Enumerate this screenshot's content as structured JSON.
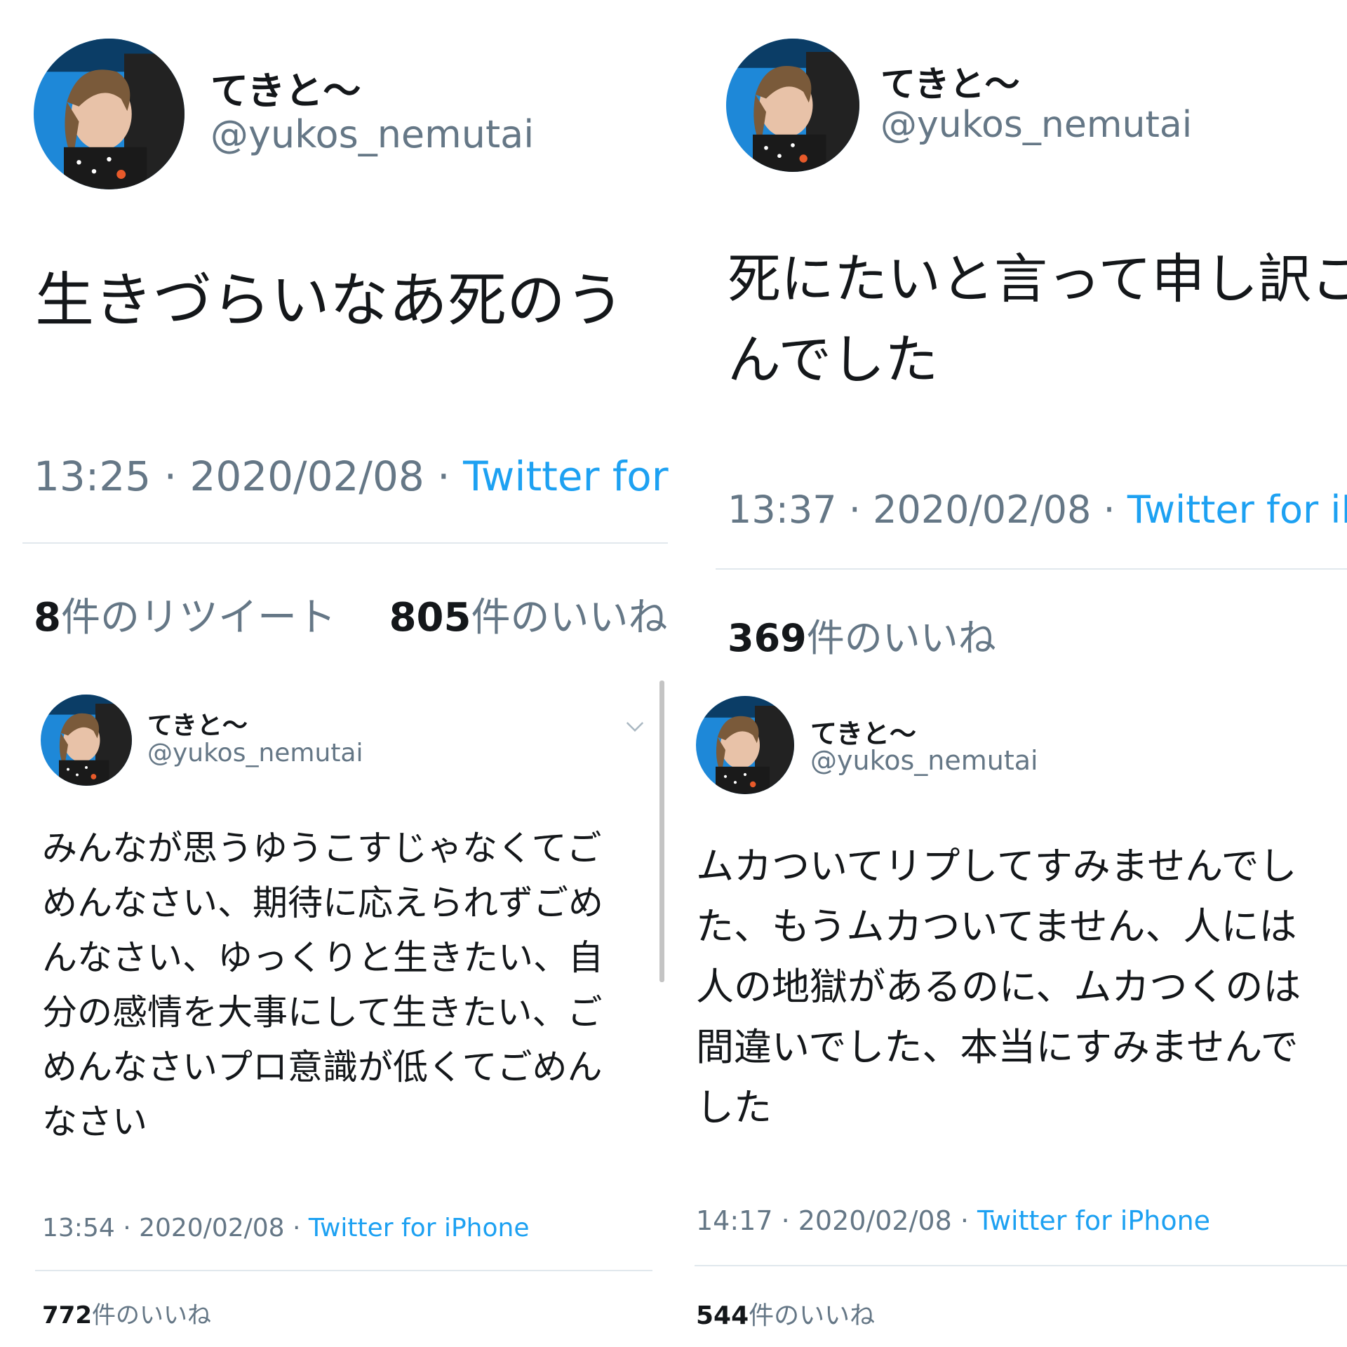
{
  "colors": {
    "text": "#14171a",
    "secondary": "#657786",
    "link": "#1da1f2",
    "divider": "#e1e8ed",
    "avatar_bg": "#1e88d8"
  },
  "icons": [
    "avatar",
    "chevron-down-icon"
  ],
  "tweets": [
    {
      "name": "てきと〜",
      "handle": "@yukos_nemutai",
      "text": "生きづらいなあ死のう",
      "time": "13:25 · 2020/02/08 · ",
      "source": "Twitter for",
      "retweets_count": "8",
      "retweets_label": "件のリツイート",
      "likes_count": "805",
      "likes_label": "件のいいね"
    },
    {
      "name": "てきと〜",
      "handle": "@yukos_nemutai",
      "text": "死にたいと言って申し訳ご",
      "text_line2": "んでした",
      "time": "13:37 · 2020/02/08 · ",
      "source": "Twitter for iPh",
      "likes_count": "369",
      "likes_label": "件のいいね"
    },
    {
      "name": "てきと〜",
      "handle": "@yukos_nemutai",
      "text": "みんなが思うゆうこすじゃなくてごめんなさい、期待に応えられずごめんなさい、ゆっくりと生きたい、自分の感情を大事にして生きたい、ごめんなさいプロ意識が低くてごめんなさい",
      "time": "13:54 · 2020/02/08 · ",
      "source": "Twitter for iPhone",
      "likes_count": "772",
      "likes_label": "件のいいね"
    },
    {
      "name": "てきと〜",
      "handle": "@yukos_nemutai",
      "text": "ムカついてリプしてすみませんでした、もうムカついてません、人には人の地獄があるのに、ムカつくのは間違いでした、本当にすみませんでした",
      "time": "14:17 · 2020/02/08 · ",
      "source": "Twitter for iPhone",
      "likes_count": "544",
      "likes_label": "件のいいね"
    }
  ]
}
